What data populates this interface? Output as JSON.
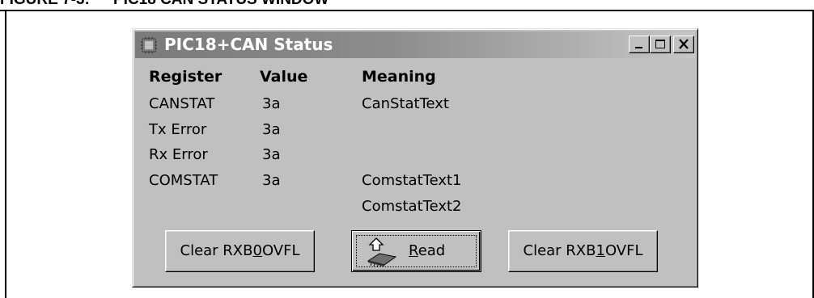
{
  "figure": {
    "label": "FIGURE 7-3:",
    "title": "PIC18 CAN STATUS WINDOW"
  },
  "window": {
    "title": "PIC18+CAN Status",
    "controls": {
      "minimize": "_",
      "maximize": "□",
      "close": "X"
    }
  },
  "table": {
    "headers": [
      "Register",
      "Value",
      "Meaning"
    ],
    "rows": [
      {
        "register": "CANSTAT",
        "value": "3a",
        "meaning": "CanStatText"
      },
      {
        "register": "Tx Error",
        "value": "3a",
        "meaning": ""
      },
      {
        "register": "Rx Error",
        "value": "3a",
        "meaning": ""
      },
      {
        "register": "COMSTAT",
        "value": "3a",
        "meaning": "ComstatText1"
      },
      {
        "register": "",
        "value": "",
        "meaning": "ComstatText2"
      }
    ]
  },
  "buttons": {
    "clear_rxb0": {
      "pre": "Clear RXB",
      "accel": "0",
      "post": "OVFL"
    },
    "read": {
      "accel": "R",
      "post": "ead",
      "icon": "read-chip-icon"
    },
    "clear_rxb1": {
      "pre": "Clear RXB",
      "accel": "1",
      "post": "OVFL"
    }
  },
  "colors": {
    "window_face": "#c0c0c0",
    "titlebar_start": "#7a7a7a",
    "titlebar_end": "#c6c6c6",
    "title_text": "#ffffff"
  }
}
